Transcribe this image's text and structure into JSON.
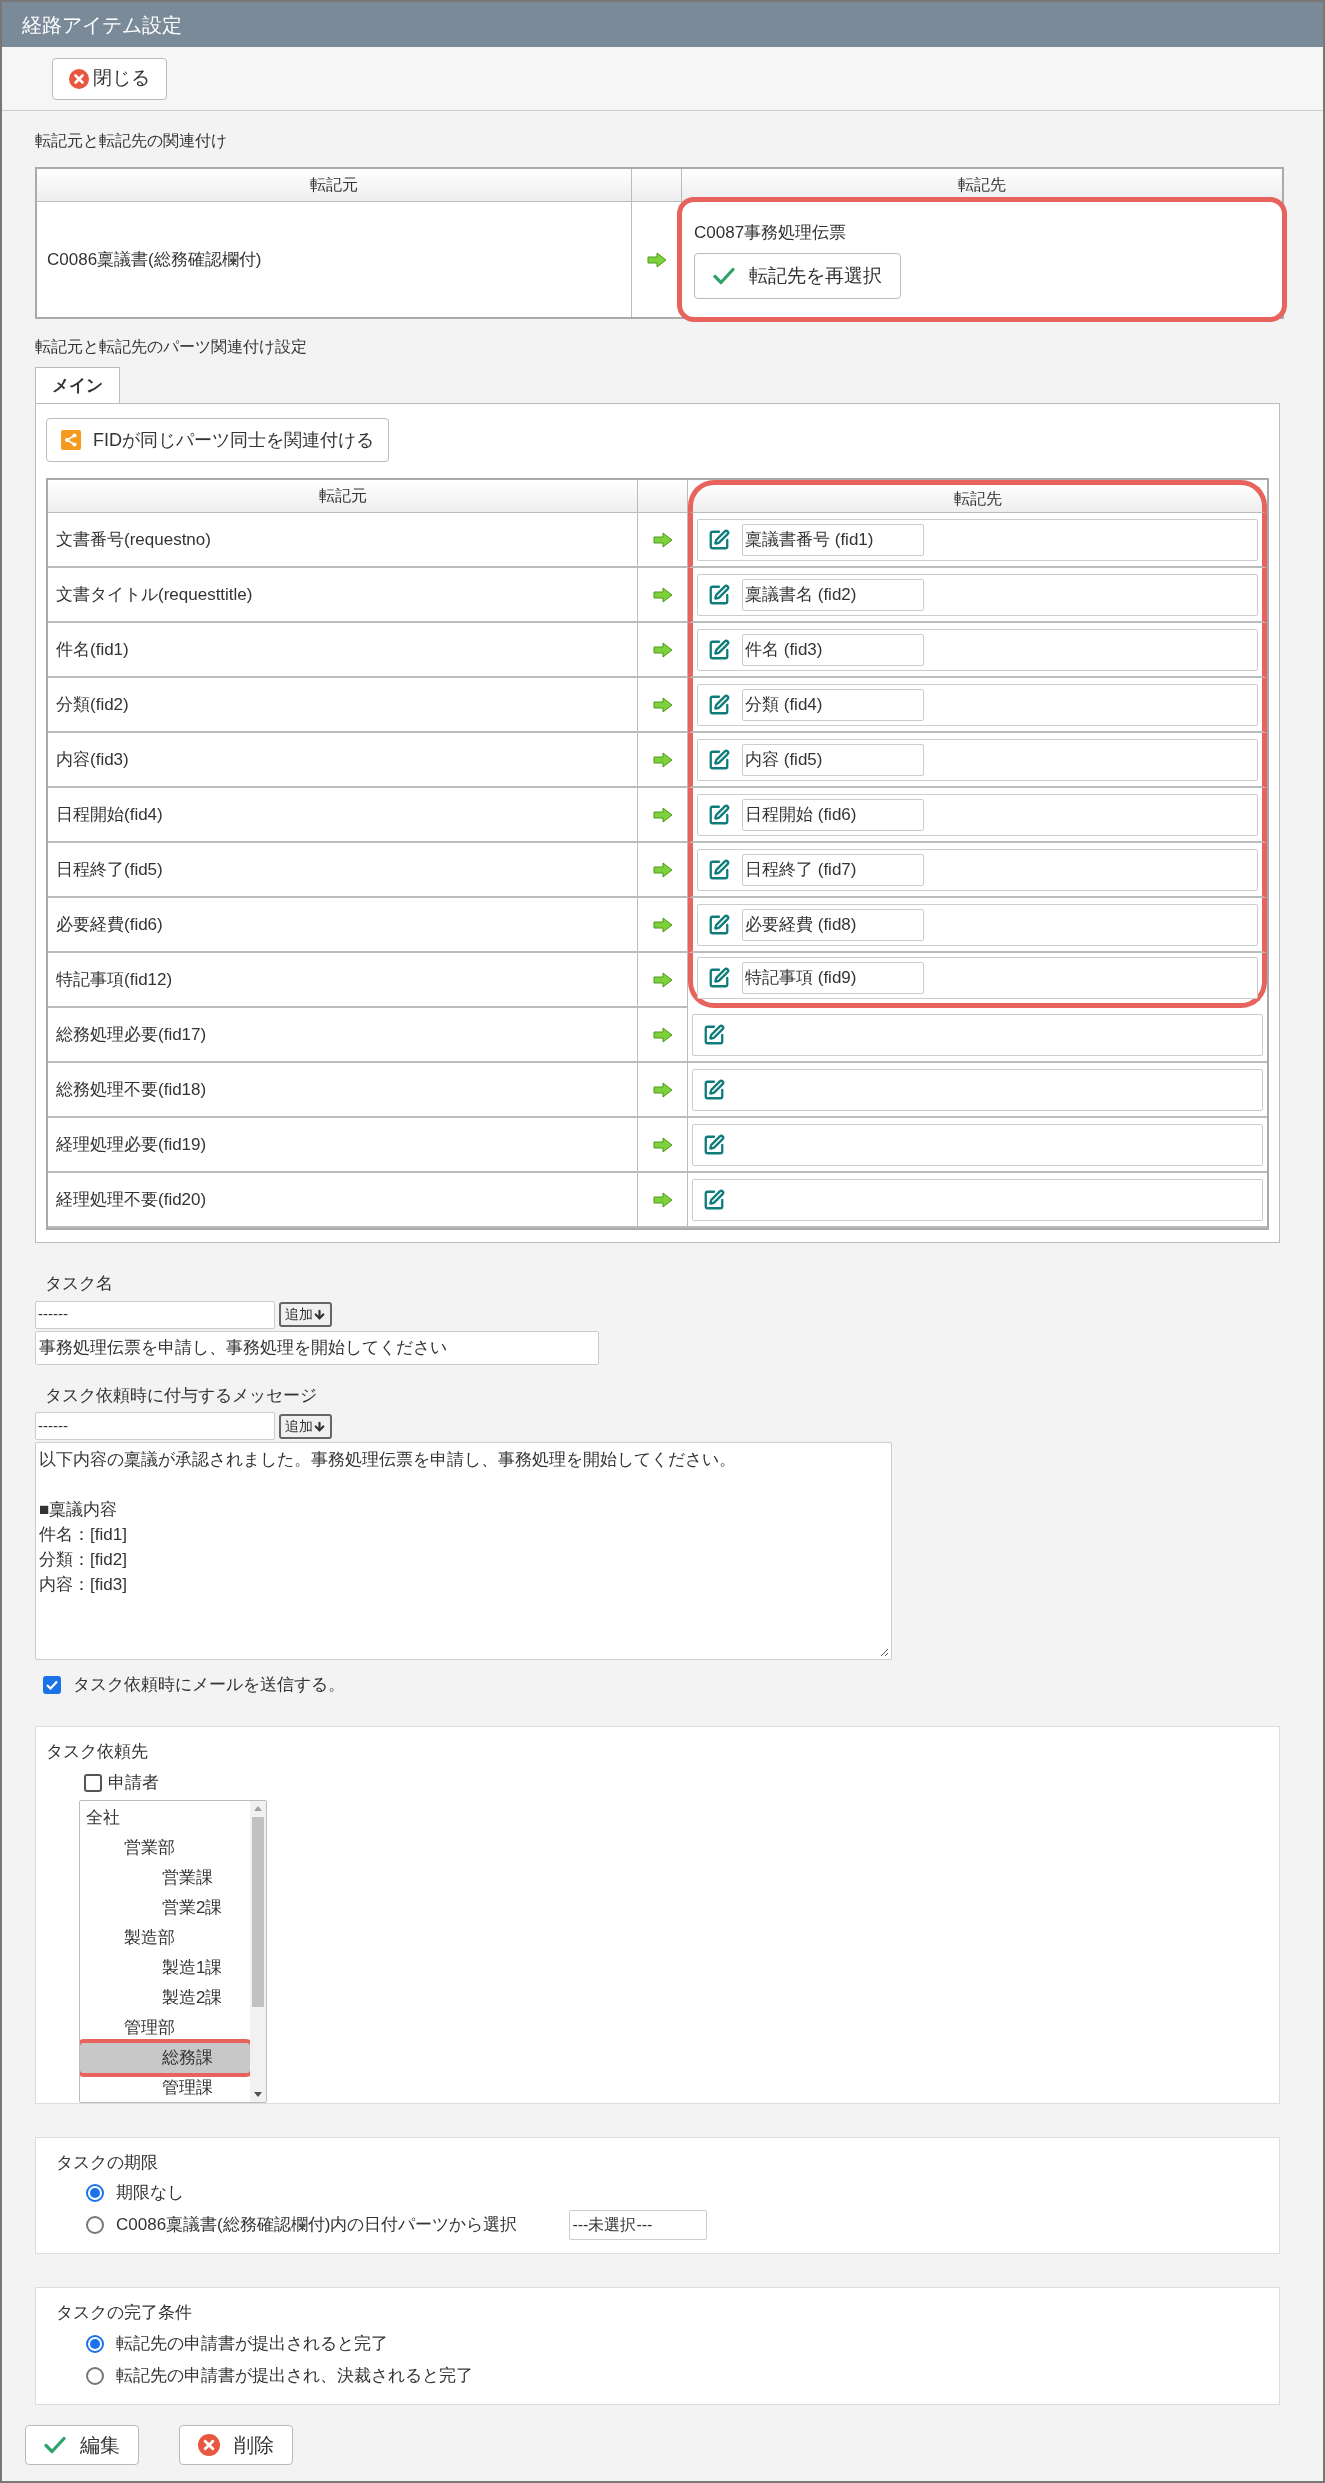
{
  "window": {
    "title": "経路アイテム設定"
  },
  "toolbar": {
    "close_button": "閉じる"
  },
  "association": {
    "heading": "転記元と転記先の関連付け",
    "columns": [
      "転記元",
      "転記先"
    ],
    "source": "C0086稟議書(総務確認欄付)",
    "destination": "C0087事務処理伝票",
    "reselect_button": "転記先を再選択",
    "destination_highlighted": true
  },
  "parts": {
    "heading": "転記元と転記先のパーツ関連付け設定",
    "tabs": [
      {
        "label": "メイン",
        "selected": true
      }
    ],
    "fid_button": "FIDが同じパーツ同士を関連付ける",
    "columns": [
      "転記元",
      "転記先"
    ],
    "rows": [
      {
        "source": "文書番号(requestno)",
        "destination": "稟議書番号 (fid1)",
        "highlighted": true
      },
      {
        "source": "文書タイトル(requesttitle)",
        "destination": "稟議書名 (fid2)",
        "highlighted": true
      },
      {
        "source": "件名(fid1)",
        "destination": "件名 (fid3)",
        "highlighted": true
      },
      {
        "source": "分類(fid2)",
        "destination": "分類 (fid4)",
        "highlighted": true
      },
      {
        "source": "内容(fid3)",
        "destination": "内容 (fid5)",
        "highlighted": true
      },
      {
        "source": "日程開始(fid4)",
        "destination": "日程開始 (fid6)",
        "highlighted": true
      },
      {
        "source": "日程終了(fid5)",
        "destination": "日程終了 (fid7)",
        "highlighted": true
      },
      {
        "source": "必要経費(fid6)",
        "destination": "必要経費 (fid8)",
        "highlighted": true
      },
      {
        "source": "特記事項(fid12)",
        "destination": "特記事項 (fid9)",
        "highlighted": true
      },
      {
        "source": "総務処理必要(fid17)",
        "highlighted": false
      },
      {
        "source": "総務処理不要(fid18)",
        "highlighted": false
      },
      {
        "source": "経理処理必要(fid19)",
        "highlighted": false
      },
      {
        "source": "経理処理不要(fid20)",
        "highlighted": false
      }
    ]
  },
  "task_name": {
    "label": "タスク名",
    "picker": "------",
    "add_button": "追加",
    "value": "事務処理伝票を申請し、事務処理を開始してください"
  },
  "message": {
    "label": "タスク依頼時に付与するメッセージ",
    "picker": "------",
    "add_button": "追加",
    "paragraphs": [
      [
        "以下内容の稟議が承認されました。事務処理伝票を申請し、事務処理を開始してください。"
      ],
      [
        "■稟議内容",
        "件名：[fid1]",
        "分類：[fid2]",
        "内容：[fid3]"
      ]
    ]
  },
  "send_mail": {
    "label": "タスク依頼時にメールを送信する。",
    "checked": true
  },
  "assignee": {
    "heading": "タスク依頼先",
    "applicant": {
      "label": "申請者",
      "checked": false
    },
    "tree": [
      {
        "label": "全社",
        "selected": false,
        "highlighted": false,
        "children": [
          {
            "label": "営業部",
            "selected": false,
            "highlighted": false,
            "children": [
              {
                "label": "営業課",
                "selected": false,
                "highlighted": false
              },
              {
                "label": "営業2課",
                "selected": false,
                "highlighted": false
              }
            ]
          },
          {
            "label": "製造部",
            "selected": false,
            "highlighted": false,
            "children": [
              {
                "label": "製造1課",
                "selected": false,
                "highlighted": false
              },
              {
                "label": "製造2課",
                "selected": false,
                "highlighted": false
              }
            ]
          },
          {
            "label": "管理部",
            "selected": false,
            "highlighted": false,
            "children": [
              {
                "label": "総務課",
                "selected": true,
                "highlighted": true
              },
              {
                "label": "管理課",
                "selected": false,
                "highlighted": false
              }
            ]
          }
        ]
      }
    ]
  },
  "deadline": {
    "heading": "タスクの期限",
    "options": [
      {
        "label": "期限なし",
        "selected": true
      },
      {
        "label": "C0086稟議書(総務確認欄付)内の日付パーツから選択",
        "selected": false,
        "select": "---未選択---"
      }
    ]
  },
  "completion": {
    "heading": "タスクの完了条件",
    "options": [
      {
        "label": "転記先の申請書が提出されると完了",
        "selected": true
      },
      {
        "label": "転記先の申請書が提出され、決裁されると完了",
        "selected": false
      }
    ]
  },
  "footer_buttons": [
    {
      "label": "編集",
      "kind": "confirm"
    },
    {
      "label": "削除",
      "kind": "delete"
    }
  ]
}
